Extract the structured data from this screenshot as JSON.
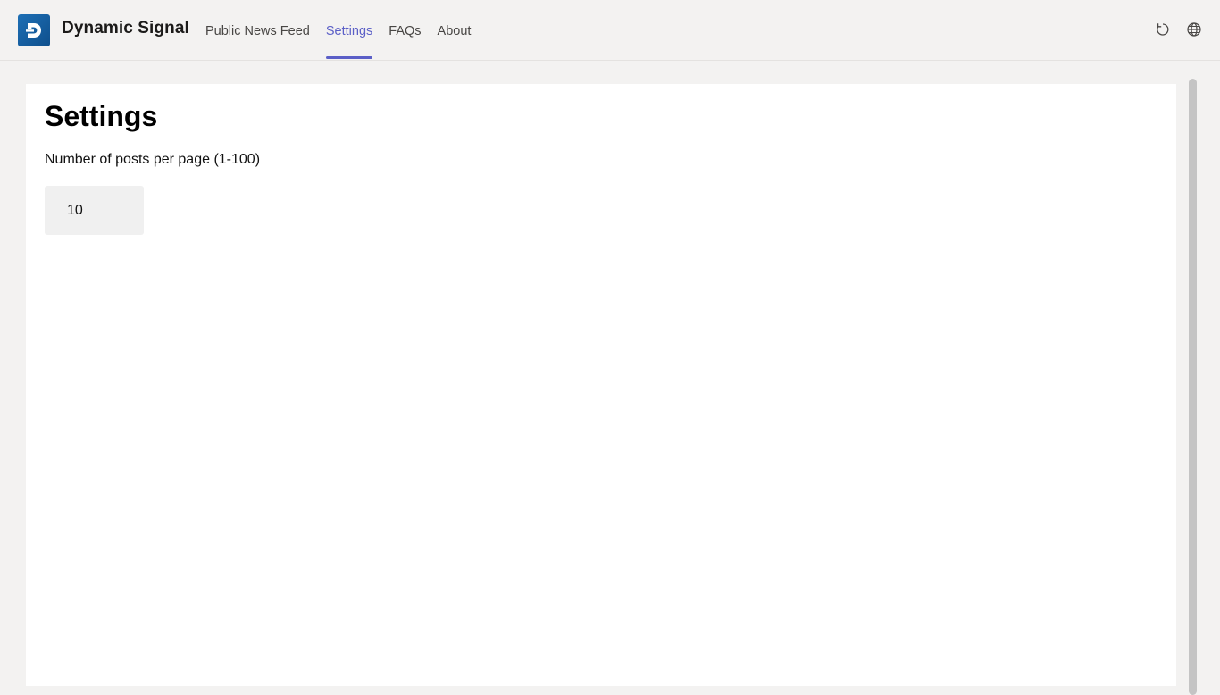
{
  "app": {
    "name": "Dynamic Signal",
    "logo_letter": "D",
    "brand_color": "#1d6fb5"
  },
  "nav": {
    "tabs": [
      {
        "label": "Public News Feed",
        "active": false
      },
      {
        "label": "Settings",
        "active": true
      },
      {
        "label": "FAQs",
        "active": false
      },
      {
        "label": "About",
        "active": false
      }
    ],
    "active_color": "#5b5fc7"
  },
  "toolbar": {
    "refresh_icon": "refresh-icon",
    "globe_icon": "globe-icon"
  },
  "page": {
    "title": "Settings",
    "posts_per_page_label": "Number of posts per page (1-100)",
    "posts_per_page_value": "10"
  }
}
